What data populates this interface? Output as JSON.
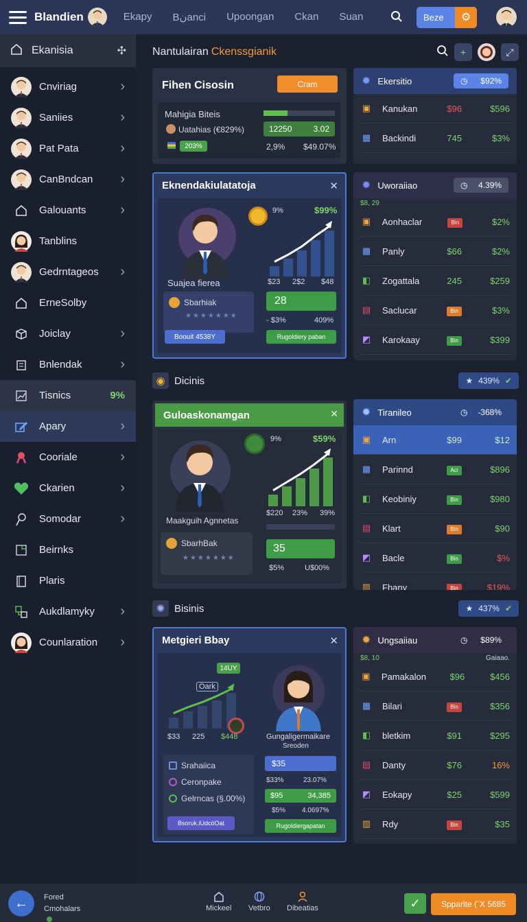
{
  "topbar": {
    "brand": "Blandien",
    "tabs": [
      "Ekapy",
      "Bنanci",
      "Upoongan",
      "Ckan",
      "Suan"
    ],
    "bet_label": "Beze",
    "colors": {
      "bar": "#2b3558",
      "accent": "#f08a24",
      "primary": "#5b84e6"
    }
  },
  "sidebar": {
    "header": "Ekanisia",
    "items": [
      {
        "label": "Cnviriag",
        "icon": "avatar-man-icon",
        "chevron": true
      },
      {
        "label": "Saniies",
        "icon": "avatar-man-icon",
        "chevron": true
      },
      {
        "label": "Pat Pata",
        "icon": "avatar-man-icon",
        "chevron": true
      },
      {
        "label": "CanBndcan",
        "icon": "avatar-man-icon",
        "chevron": true
      },
      {
        "label": "Galouants",
        "icon": "home-icon",
        "chevron": true
      },
      {
        "label": "Tanblins",
        "icon": "avatar-woman-icon",
        "chevron": false
      },
      {
        "label": "Gedrntageos",
        "icon": "avatar-man-icon",
        "chevron": true
      },
      {
        "label": "ErneSolby",
        "icon": "home-icon",
        "chevron": false
      },
      {
        "label": "Joiclay",
        "icon": "box-icon",
        "chevron": true
      },
      {
        "label": "Bnlendak",
        "icon": "building-icon",
        "chevron": true
      },
      {
        "label": "Tisnics",
        "icon": "chart-icon",
        "chevron": false,
        "value": "9%"
      },
      {
        "label": "Apary",
        "icon": "edit-icon",
        "chevron": true
      },
      {
        "label": "Cooriale",
        "icon": "ribbon-icon",
        "chevron": true
      },
      {
        "label": "Ckarien",
        "icon": "heart-icon",
        "chevron": true
      },
      {
        "label": "Somodar",
        "icon": "pin-icon",
        "chevron": true
      },
      {
        "label": "Beirnks",
        "icon": "frame-icon",
        "chevron": false
      },
      {
        "label": "Plaris",
        "icon": "document-icon",
        "chevron": false
      },
      {
        "label": "Aukdlamyky",
        "icon": "network-icon",
        "chevron": true
      },
      {
        "label": "Counlaration",
        "icon": "avatar-woman-icon",
        "chevron": true
      }
    ]
  },
  "header": {
    "title": "Nantulairan",
    "highlight": "Ckenssgianik"
  },
  "summary": {
    "title": "Fihen Cisosin",
    "button": "Cram",
    "row1_label": "Mahigia Biteis",
    "row2_label": "Uatahias (€829%)",
    "row3_badge": "203%",
    "cell_a": "12250",
    "cell_b": "3.02",
    "cell_c": "2,9%",
    "cell_d": "$49.07%"
  },
  "feature1": {
    "title": "Eknendakiulatatoja",
    "name": "Suajea fierea",
    "pct": "9%",
    "value": "$99%",
    "xlabels": [
      "$23",
      "2$2",
      "$48"
    ],
    "bars": [
      18,
      30,
      44,
      62,
      78
    ],
    "panel_label": "Sbarhiak",
    "stat": "28",
    "stat_a": "- $3%",
    "stat_b": "409%",
    "blue_btn": "Boouit 4538Y",
    "green_btn": "Rugoldiery paban"
  },
  "section1": {
    "label": "Dicinis",
    "badge": "439%"
  },
  "feature2": {
    "title": "Guloaskonamgan",
    "name": "Maakguih Agnnetas",
    "pct": "9%",
    "value": "$59%",
    "xlabels": [
      "$220",
      "23%",
      "39%"
    ],
    "bars": [
      20,
      34,
      48,
      64,
      82
    ],
    "panel_label": "SbarhBak",
    "stat": "35",
    "stat_a": "$5%",
    "stat_b": "U$00%"
  },
  "section2": {
    "label": "Bisinis",
    "badge": "437%"
  },
  "feature3": {
    "title": "Metgieri Bbay",
    "chip": "14UY",
    "mini_label": "Oark",
    "xlabels": [
      "$33",
      "225",
      "$448"
    ],
    "bars": [
      22,
      34,
      44,
      56,
      70
    ],
    "name": "Gungaligermaikare",
    "subname": "Sreoden",
    "list": [
      "Srahaiica",
      "Ceronpake",
      "Gelrncas (§.00%)"
    ],
    "blue_a": "$35",
    "row_a": "$33%",
    "row_b": "23.07%",
    "green_a": "$95",
    "green_b": "34,385",
    "row_c": "$5%",
    "row_d": "4.0697%",
    "blue_btn": "Bsoruk.iUdcöOat",
    "green_btn": "Rugoldiergapatan"
  },
  "panel1": {
    "title": "Ekersitio",
    "badge": "$92%",
    "rows": [
      {
        "name": "Kanukan",
        "v1": "$96",
        "v2": "$596",
        "v1c": "red"
      },
      {
        "name": "Backindi",
        "v1": "745",
        "v2": "$3%"
      }
    ]
  },
  "panel2": {
    "title": "Uworaiiao",
    "badge": "4.39%",
    "sub": "$8, 29",
    "rows": [
      {
        "name": "Aonhaclar",
        "tag": "Bin",
        "tagc": "#c8443d",
        "v1": "",
        "v2": "$2%"
      },
      {
        "name": "Panly",
        "v1": "$66",
        "v2": "$2%"
      },
      {
        "name": "Zogattala",
        "v1": "245",
        "v2": "$259"
      },
      {
        "name": "Saclucar",
        "tag": "Bin",
        "tagc": "#e07a2a",
        "v1": "",
        "v2": "$3%"
      },
      {
        "name": "Karokaay",
        "tag": "Bin",
        "tagc": "#3f9b48",
        "v1": "",
        "v2": "$399"
      }
    ]
  },
  "panel3": {
    "title": "Tiranileo",
    "badge": "-368%",
    "rows": [
      {
        "name": "Arn",
        "v1": "$99",
        "v2": "$12",
        "hl": true
      },
      {
        "name": "Parinnd",
        "tag": "Aci",
        "tagc": "#3f9b48",
        "v1": "",
        "v2": "$896"
      },
      {
        "name": "Keobiniy",
        "tag": "Bin",
        "tagc": "#3f9b48",
        "v1": "",
        "v2": "$980"
      },
      {
        "name": "Klart",
        "tag": "Bin",
        "tagc": "#e07a2a",
        "v1": "",
        "v2": "$90"
      },
      {
        "name": "Bacle",
        "tag": "Bin",
        "tagc": "#3f9b48",
        "v1": "",
        "v2": "$%",
        "v2c": "red"
      },
      {
        "name": "Fhany",
        "tag": "Bin",
        "tagc": "#c8443d",
        "v1": "",
        "v2": "$19%",
        "v2c": "red"
      }
    ]
  },
  "panel4": {
    "title": "Ungsaiiau",
    "badge": "$89%",
    "sub_left": "$8, 10",
    "sub_right": "Gaiaao.",
    "rows": [
      {
        "name": "Pamakalon",
        "v1": "$96",
        "v2": "$456"
      },
      {
        "name": "Bilari",
        "tag": "Bin",
        "tagc": "#c8443d",
        "v1": "",
        "v2": "$356"
      },
      {
        "name": "bletkim",
        "v1": "$91",
        "v2": "$295"
      },
      {
        "name": "Danty",
        "v1": "$76",
        "v2": "16%",
        "v2c": "or"
      },
      {
        "name": "Eokapy",
        "v1": "$25",
        "v2": "$599"
      },
      {
        "name": "Rdy",
        "tag": "Bin",
        "tagc": "#c8443d",
        "v1": "",
        "v2": "$35"
      }
    ]
  },
  "footer": {
    "stack_top": "Fored",
    "stack_bottom": "Cmohalars",
    "tabs": [
      {
        "label": "Mickeel",
        "icon": "home-icon"
      },
      {
        "label": "Vetbro",
        "icon": "globe-icon"
      },
      {
        "label": "Dibeatias",
        "icon": "user-icon"
      }
    ],
    "cta": "Spparite (¨X 5685"
  }
}
